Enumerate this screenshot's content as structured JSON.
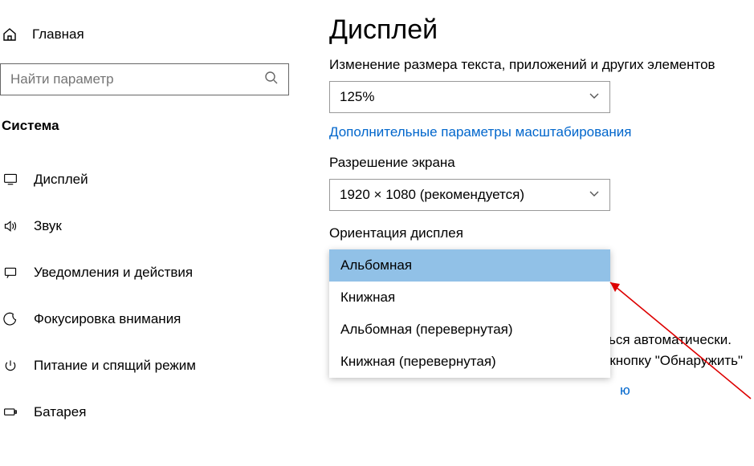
{
  "sidebar": {
    "home_label": "Главная",
    "search_placeholder": "Найти параметр",
    "category": "Система",
    "items": [
      {
        "label": "Дисплей"
      },
      {
        "label": "Звук"
      },
      {
        "label": "Уведомления и действия"
      },
      {
        "label": "Фокусировка внимания"
      },
      {
        "label": "Питание и спящий режим"
      },
      {
        "label": "Батарея"
      }
    ]
  },
  "main": {
    "title": "Дисплей",
    "scale_label": "Изменение размера текста, приложений и других элементов",
    "scale_value": "125%",
    "scale_link": "Дополнительные параметры масштабирования",
    "resolution_label": "Разрешение экрана",
    "resolution_value": "1920 × 1080 (рекомендуется)",
    "orientation_label": "Ориентация дисплея",
    "orientation_options": [
      "Альбомная",
      "Книжная",
      "Альбомная (перевернутая)",
      "Книжная (перевернутая)"
    ],
    "partial_link_fragment": "ю",
    "footer_text": "Старые дисплеи могут не всегда подключаться автоматически. Чтобы попытаться подключить их, нажмите кнопку \"Обнаружить\""
  }
}
